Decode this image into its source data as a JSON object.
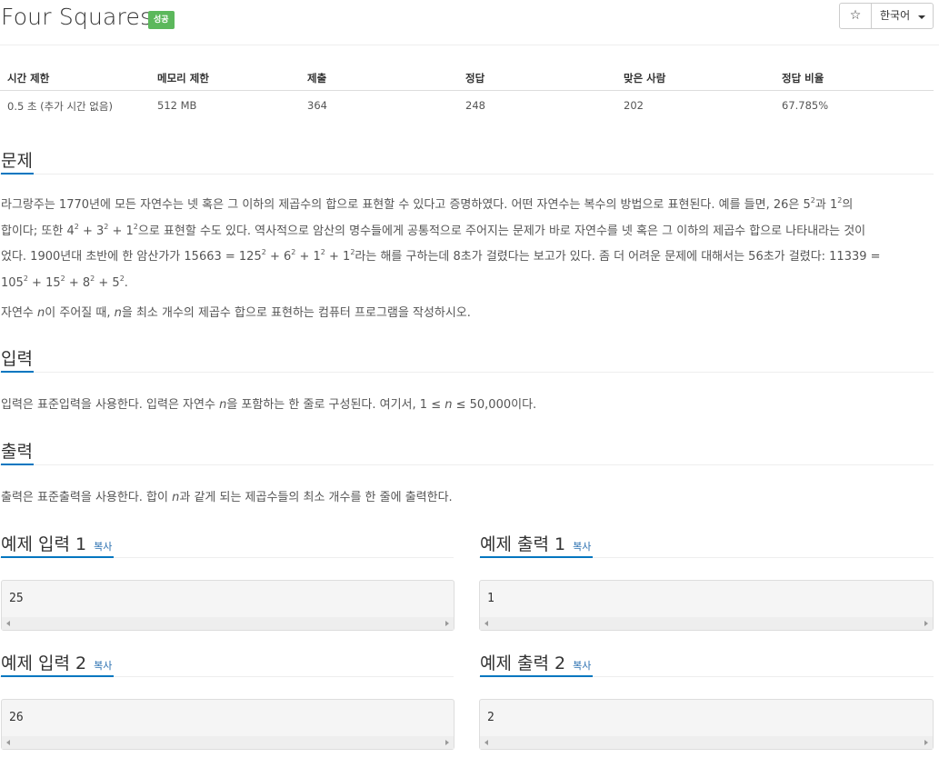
{
  "problem": {
    "title": "Four Squares",
    "status_badge": "성공",
    "star_icon": "☆",
    "language": "한국어"
  },
  "stats": {
    "headers": [
      "시간 제한",
      "메모리 제한",
      "제출",
      "정답",
      "맞은 사람",
      "정답 비율"
    ],
    "values": [
      "0.5 초 (추가 시간 없음)",
      "512 MB",
      "364",
      "248",
      "202",
      "67.785%"
    ]
  },
  "sections": {
    "problem_heading": "문제",
    "input_heading": "입력",
    "output_heading": "출력"
  },
  "description": {
    "line1_a": "라그랑주는 1770년에 모든 자연수는 넷 혹은 그 이하의 제곱수의 합으로 표현할 수 있다고 증명하였다. 어떤 자연수는 복수의 방법으로 표현된다. 예를 들면, 26은 5",
    "line1_b": "과 1",
    "line1_c": "의",
    "line2_a": "합이다; 또한 4",
    "line2_b": " + 3",
    "line2_c": " + 1",
    "line2_d": "으로 표현할 수도 있다. 역사적으로 암산의 명수들에게 공통적으로 주어지는 문제가 바로 자연수를 넷 혹은 그 이하의 제곱수 합으로 나타내라는 것이",
    "line3_a": "었다. 1900년대 초반에 한 암산가가 15663 = 125",
    "line3_b": " + 6",
    "line3_c": " + 1",
    "line3_d": " + 1",
    "line3_e": "라는 해를 구하는데 8초가 걸렸다는 보고가 있다. 좀 더 어려운 문제에 대해서는 56초가 걸렸다: 11339 =",
    "line4_a": "105",
    "line4_b": " + 15",
    "line4_c": " + 8",
    "line4_d": " + 5",
    "line4_e": ".",
    "sup": "2",
    "task_a": "자연수 ",
    "task_n1": "n",
    "task_b": "이 주어질 때, ",
    "task_n2": "n",
    "task_c": "을 최소 개수의 제곱수 합으로 표현하는 컴퓨터 프로그램을 작성하시오."
  },
  "input_desc": {
    "a": "입력은 표준입력을 사용한다. 입력은 자연수 ",
    "n1": "n",
    "b": "을 포함하는 한 줄로 구성된다. 여기서, 1 ≤ ",
    "n2": "n",
    "c": " ≤ 50,000이다."
  },
  "output_desc": {
    "a": "출력은 표준출력을 사용한다. 합이 ",
    "n": "n",
    "b": "과 같게 되는 제곱수들의 최소 개수를 한 줄에 출력한다."
  },
  "samples": {
    "copy_label": "복사",
    "input1_title": "예제 입력 1",
    "output1_title": "예제 출력 1",
    "input2_title": "예제 입력 2",
    "output2_title": "예제 출력 2",
    "input1": "25",
    "output1": "1",
    "input2": "26",
    "output2": "2"
  }
}
